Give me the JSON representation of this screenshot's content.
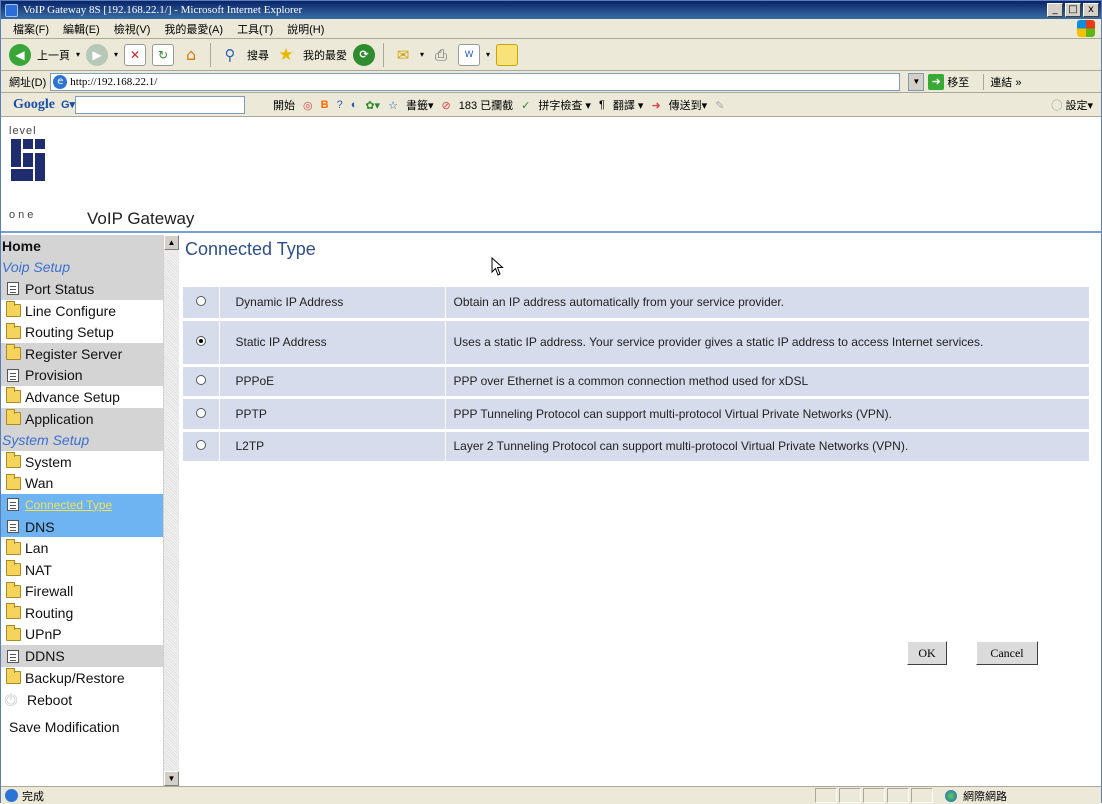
{
  "window": {
    "title": "VoIP Gateway 8S [192.168.22.1/] - Microsoft Internet Explorer",
    "controls": {
      "minimize": "_",
      "maximize": "□",
      "close": "x"
    }
  },
  "menubar": {
    "items": [
      "檔案(F)",
      "編輯(E)",
      "檢視(V)",
      "我的最愛(A)",
      "工具(T)",
      "說明(H)"
    ]
  },
  "toolbar": {
    "back_label": "上一頁",
    "search_label": "搜尋",
    "favorites_label": "我的最愛"
  },
  "address": {
    "label": "網址(D)",
    "url": "http://192.168.22.1/",
    "go_label": "移至",
    "links_label": "連結 »"
  },
  "googlebar": {
    "logo": "Google",
    "g_button": "G▾",
    "start_label": "開始",
    "bookmarks_label": "書籤▾",
    "blocked_label": "183 已攔截",
    "spell_label": "拼字檢查 ▾",
    "translate_label": "翻譯 ▾",
    "send_label": "傳送到▾",
    "settings_label": "設定▾"
  },
  "header": {
    "logo_top": "level",
    "logo_bottom": "one",
    "product_title": "VoIP Gateway"
  },
  "sidebar": {
    "home": "Home",
    "voip_setup": "Voip Setup",
    "voip_items": [
      {
        "label": "Port Status",
        "icon": "doc"
      },
      {
        "label": "Line Configure",
        "icon": "folder"
      },
      {
        "label": "Routing Setup",
        "icon": "folder"
      },
      {
        "label": "Register Server",
        "icon": "folder"
      },
      {
        "label": "Provision",
        "icon": "doc"
      },
      {
        "label": "Advance Setup",
        "icon": "folder"
      },
      {
        "label": "Application",
        "icon": "folder"
      }
    ],
    "system_setup": "System Setup",
    "system": "System",
    "wan": "Wan",
    "connected_type": "Connected Type",
    "dns": "DNS",
    "lan": "Lan",
    "nat": "NAT",
    "firewall": "Firewall",
    "routing": "Routing",
    "upnp": "UPnP",
    "ddns": "DDNS",
    "backup": "Backup/Restore",
    "reboot": "Reboot",
    "save": "Save Modification"
  },
  "main": {
    "title": "Connected Type",
    "options": [
      {
        "name": "Dynamic IP Address",
        "desc": "Obtain an IP address automatically from your service provider.",
        "selected": false
      },
      {
        "name": "Static IP Address",
        "desc": "Uses a static IP address. Your service provider gives a static IP address to access Internet services.",
        "selected": true
      },
      {
        "name": "PPPoE",
        "desc": "PPP over Ethernet is a common connection method used for xDSL",
        "selected": false
      },
      {
        "name": "PPTP",
        "desc": "PPP Tunneling Protocol can support multi-protocol Virtual Private Networks (VPN).",
        "selected": false
      },
      {
        "name": "L2TP",
        "desc": "Layer 2 Tunneling Protocol can support multi-protocol Virtual Private Networks (VPN).",
        "selected": false
      }
    ],
    "ok_label": "OK",
    "cancel_label": "Cancel"
  },
  "statusbar": {
    "status": "完成",
    "zone": "網際網路"
  },
  "colors": {
    "sidebar_gray": "#d4d4d4",
    "sidebar_selected": "#6fb4f2",
    "section_blue": "#3a6fd1",
    "table_row": "#d6dcec",
    "title_blue": "#2e4f8a"
  }
}
